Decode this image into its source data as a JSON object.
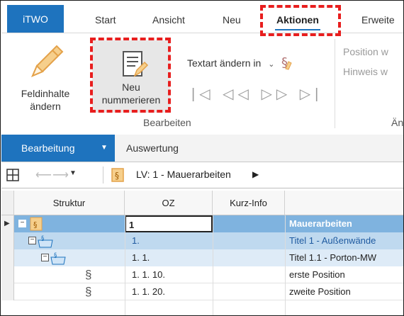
{
  "tabs": {
    "app": "iTWO",
    "start": "Start",
    "ansicht": "Ansicht",
    "neu": "Neu",
    "aktionen": "Aktionen",
    "erweitert": "Erweite"
  },
  "ribbon": {
    "feldinhalte_line1": "Feldinhalte",
    "feldinhalte_line2": "ändern",
    "renum_line1": "Neu",
    "renum_line2": "nummerieren",
    "textart": "Textart ändern in",
    "group_bearbeiten": "Bearbeiten",
    "position": "Position w",
    "hinweis": "Hinweis w",
    "group_right": "Än"
  },
  "bar": {
    "bearbeitung": "Bearbeitung",
    "auswertung": "Auswertung"
  },
  "nav": {
    "breadcrumb": "LV: 1 - Mauerarbeiten"
  },
  "grid": {
    "headers": {
      "struktur": "Struktur",
      "oz": "OZ",
      "kurzinfo": "Kurz-Info"
    },
    "rows": [
      {
        "oz": "1",
        "text": "Mauerarbeiten"
      },
      {
        "oz": "1.",
        "text": "Titel 1 - Außenwände"
      },
      {
        "oz": "1. 1.",
        "text": "Titel 1.1 - Porton-MW"
      },
      {
        "oz": "1. 1. 10.",
        "text": "erste Position"
      },
      {
        "oz": "1. 1. 20.",
        "text": "zweite Position"
      }
    ]
  },
  "colors": {
    "accent": "#1e73be",
    "highlight": "#e81e1e",
    "row_selected": "#7fb3df"
  },
  "icons": [
    "pencil-icon",
    "renumber-icon",
    "paragraph-icon",
    "nav-first-icon",
    "nav-back-icon",
    "nav-forward-icon",
    "nav-last-icon",
    "grid-icon",
    "lv-icon",
    "folder-icon",
    "section-icon"
  ]
}
